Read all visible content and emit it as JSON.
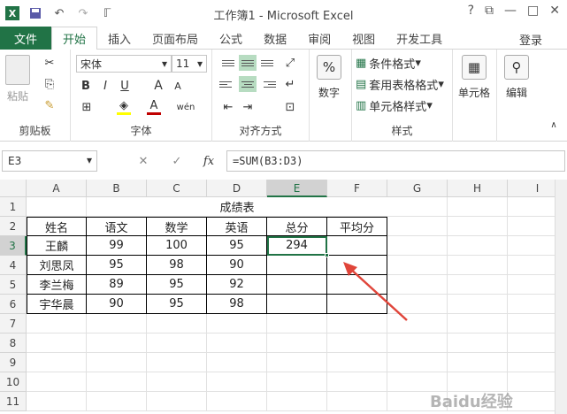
{
  "title": "工作簿1 - Microsoft Excel",
  "window": {
    "help": "?",
    "restore": "⧉",
    "minimize": "—",
    "maximize": "□",
    "close": "✕"
  },
  "qat": {
    "save": "💾",
    "undo": "↶",
    "redo": "↷",
    "touch": "ℾ"
  },
  "menu": {
    "file": "文件",
    "tabs": [
      "开始",
      "插入",
      "页面布局",
      "公式",
      "数据",
      "审阅",
      "视图",
      "开发工具"
    ],
    "login": "登录"
  },
  "ribbon": {
    "clipboard": {
      "paste": "粘贴",
      "label": "剪贴板"
    },
    "font": {
      "name": "宋体",
      "size": "11",
      "bold": "B",
      "italic": "I",
      "underline": "U",
      "grow": "A",
      "shrink": "A",
      "label": "字体",
      "fill_color": "#ffff00",
      "font_color": "#c00000",
      "phonetic": "wén"
    },
    "alignment": {
      "label": "对齐方式"
    },
    "number": {
      "label": "数字",
      "icon": "%"
    },
    "styles": {
      "cond": "条件格式",
      "table": "套用表格格式",
      "cell": "单元格样式",
      "label": "样式"
    },
    "cells": {
      "label": "单元格"
    },
    "editing": {
      "label": "编辑"
    }
  },
  "formula_bar": {
    "name": "E3",
    "fx": "fx",
    "formula": "=SUM(B3:D3)",
    "cancel": "✕",
    "enter": "✓"
  },
  "columns": [
    "A",
    "B",
    "C",
    "D",
    "E",
    "F",
    "G",
    "H",
    "I"
  ],
  "rows": [
    "1",
    "2",
    "3",
    "4",
    "5",
    "6",
    "7",
    "8",
    "9",
    "10",
    "11"
  ],
  "sheet": {
    "title": "成绩表",
    "headers": [
      "姓名",
      "语文",
      "数学",
      "英语",
      "总分",
      "平均分"
    ],
    "data": [
      [
        "王麟",
        "99",
        "100",
        "95",
        "294",
        ""
      ],
      [
        "刘思凤",
        "95",
        "98",
        "90",
        "",
        ""
      ],
      [
        "李兰梅",
        "89",
        "95",
        "92",
        "",
        ""
      ],
      [
        "宇华晨",
        "90",
        "95",
        "98",
        "",
        ""
      ]
    ]
  },
  "watermark": "Baidu经验",
  "accent": "#217346"
}
